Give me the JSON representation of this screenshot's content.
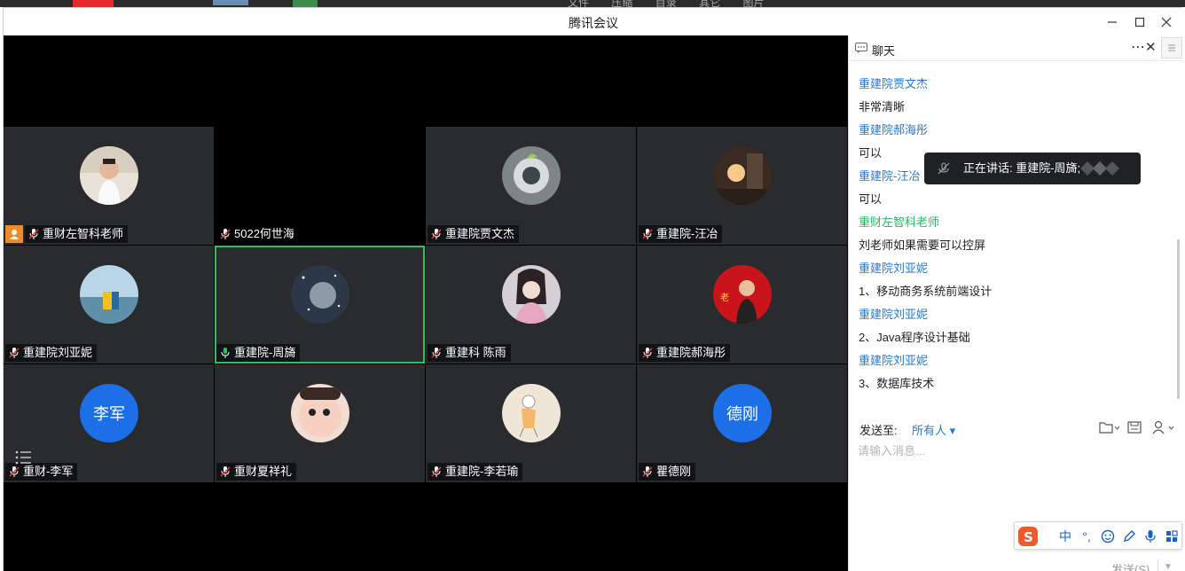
{
  "window": {
    "title": "腾讯会议"
  },
  "background_tabs": [
    "文件",
    "压缩",
    "目录",
    "其它",
    "图片"
  ],
  "participants": [
    {
      "name": "重财左智科老师",
      "host": true
    },
    {
      "name": "5022何世海"
    },
    {
      "name": "重建院贾文杰"
    },
    {
      "name": "重建院-汪冶"
    },
    {
      "name": "重建院刘亚妮"
    },
    {
      "name": "重建院-周旖",
      "active_speaker": true
    },
    {
      "name": "重建科 陈雨"
    },
    {
      "name": "重建院郝海彤"
    },
    {
      "name": "重财-李军",
      "avatar_text": "李军"
    },
    {
      "name": "重财夏祥礼"
    },
    {
      "name": "重建院-李若瑜"
    },
    {
      "name": "瞿德刚",
      "avatar_text": "德刚"
    }
  ],
  "speaking_indicator": {
    "label": "正在讲话: 重建院-周旖;"
  },
  "chat": {
    "title": "聊天",
    "messages": [
      {
        "sender": "重建院贾文杰",
        "text": "非常清晰"
      },
      {
        "sender": "重建院郝海彤",
        "text": "可以"
      },
      {
        "sender": "重建院-汪冶",
        "text": "可以"
      },
      {
        "sender": "重财左智科老师",
        "text": "刘老师如果需要可以控屏",
        "sender_color": "green"
      },
      {
        "sender": "重建院刘亚妮",
        "text": "1、移动商务系统前端设计"
      },
      {
        "sender": "重建院刘亚妮",
        "text": "2、Java程序设计基础"
      },
      {
        "sender": "重建院刘亚妮",
        "text": "3、数据库技术"
      }
    ],
    "send_to_label": "发送至:",
    "send_to_value": "所有人",
    "input_placeholder": "请输入消息...",
    "send_button": "发送(S)"
  },
  "ime": {
    "items": [
      "中",
      "°,"
    ]
  },
  "colors": {
    "speaker_outline": "#2dbf5f",
    "sender_blue": "#2b78c9",
    "sender_green": "#29b765",
    "avatar_blue": "#1d6fe8",
    "host_orange": "#f18a2a"
  }
}
